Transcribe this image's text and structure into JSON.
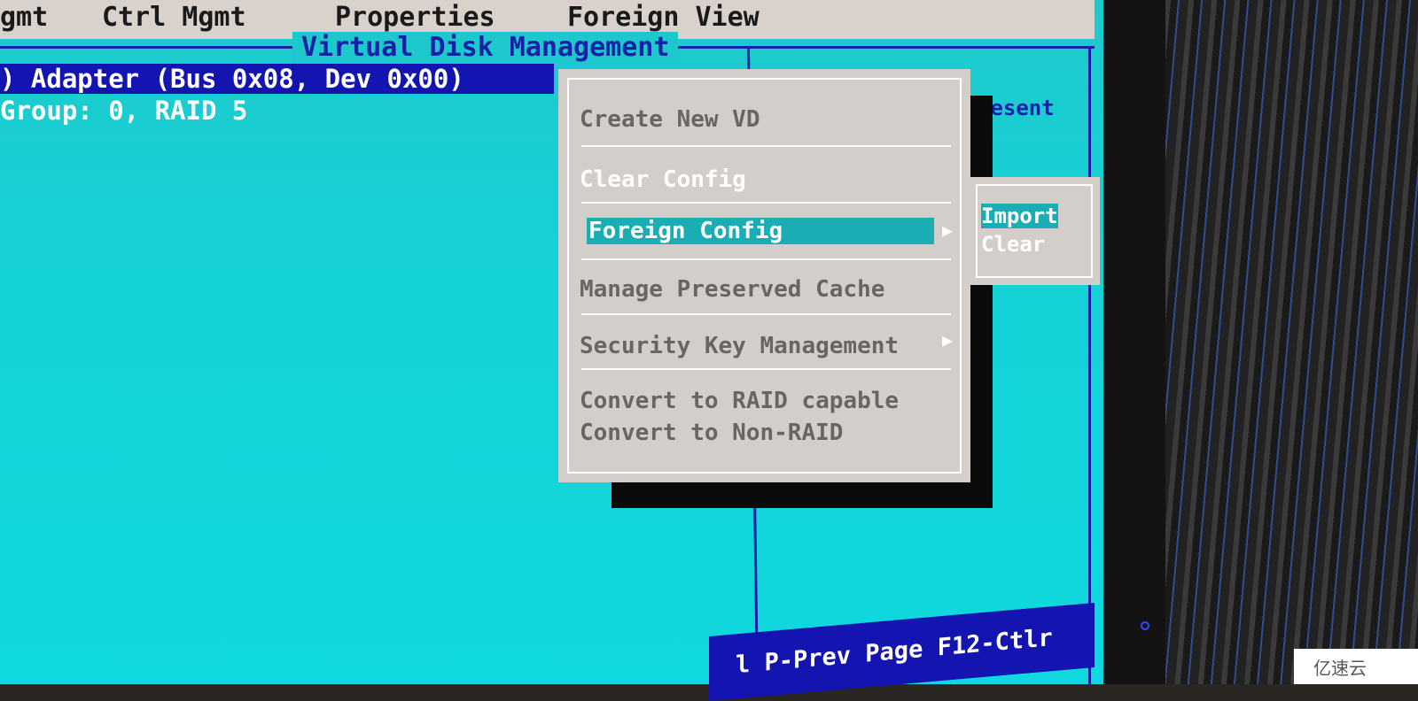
{
  "menubar": {
    "items": [
      "gmt",
      "Ctrl Mgmt",
      "Properties",
      "Foreign View"
    ]
  },
  "panel": {
    "title": "Virtual Disk Management",
    "adapter": ") Adapter (Bus 0x08, Dev 0x00)",
    "group": "Group: 0, RAID 5",
    "right_label": "resent"
  },
  "popup": {
    "items": [
      {
        "label": "Create New VD",
        "state": "disabled"
      },
      {
        "label": "Clear Config",
        "state": "enabled"
      },
      {
        "label": "Foreign Config",
        "state": "selected",
        "submenu": true
      },
      {
        "label": "Manage Preserved Cache",
        "state": "disabled"
      },
      {
        "label": "Security Key Management",
        "state": "disabled",
        "submenu": true
      },
      {
        "label": "Convert to RAID capable",
        "state": "disabled"
      },
      {
        "label": "Convert to Non-RAID",
        "state": "disabled"
      }
    ]
  },
  "submenu": {
    "items": [
      {
        "label": "Import",
        "state": "selected"
      },
      {
        "label": "Clear",
        "state": "enabled"
      }
    ]
  },
  "footer": {
    "text": "l P-Prev Page F12-Ctlr"
  },
  "watermark": {
    "text": "亿速云"
  },
  "colors": {
    "screen": "#15d2d6",
    "highlight_blue": "#1414b0",
    "menu_gray": "#d4cecb",
    "selection": "#1aaeb4"
  }
}
